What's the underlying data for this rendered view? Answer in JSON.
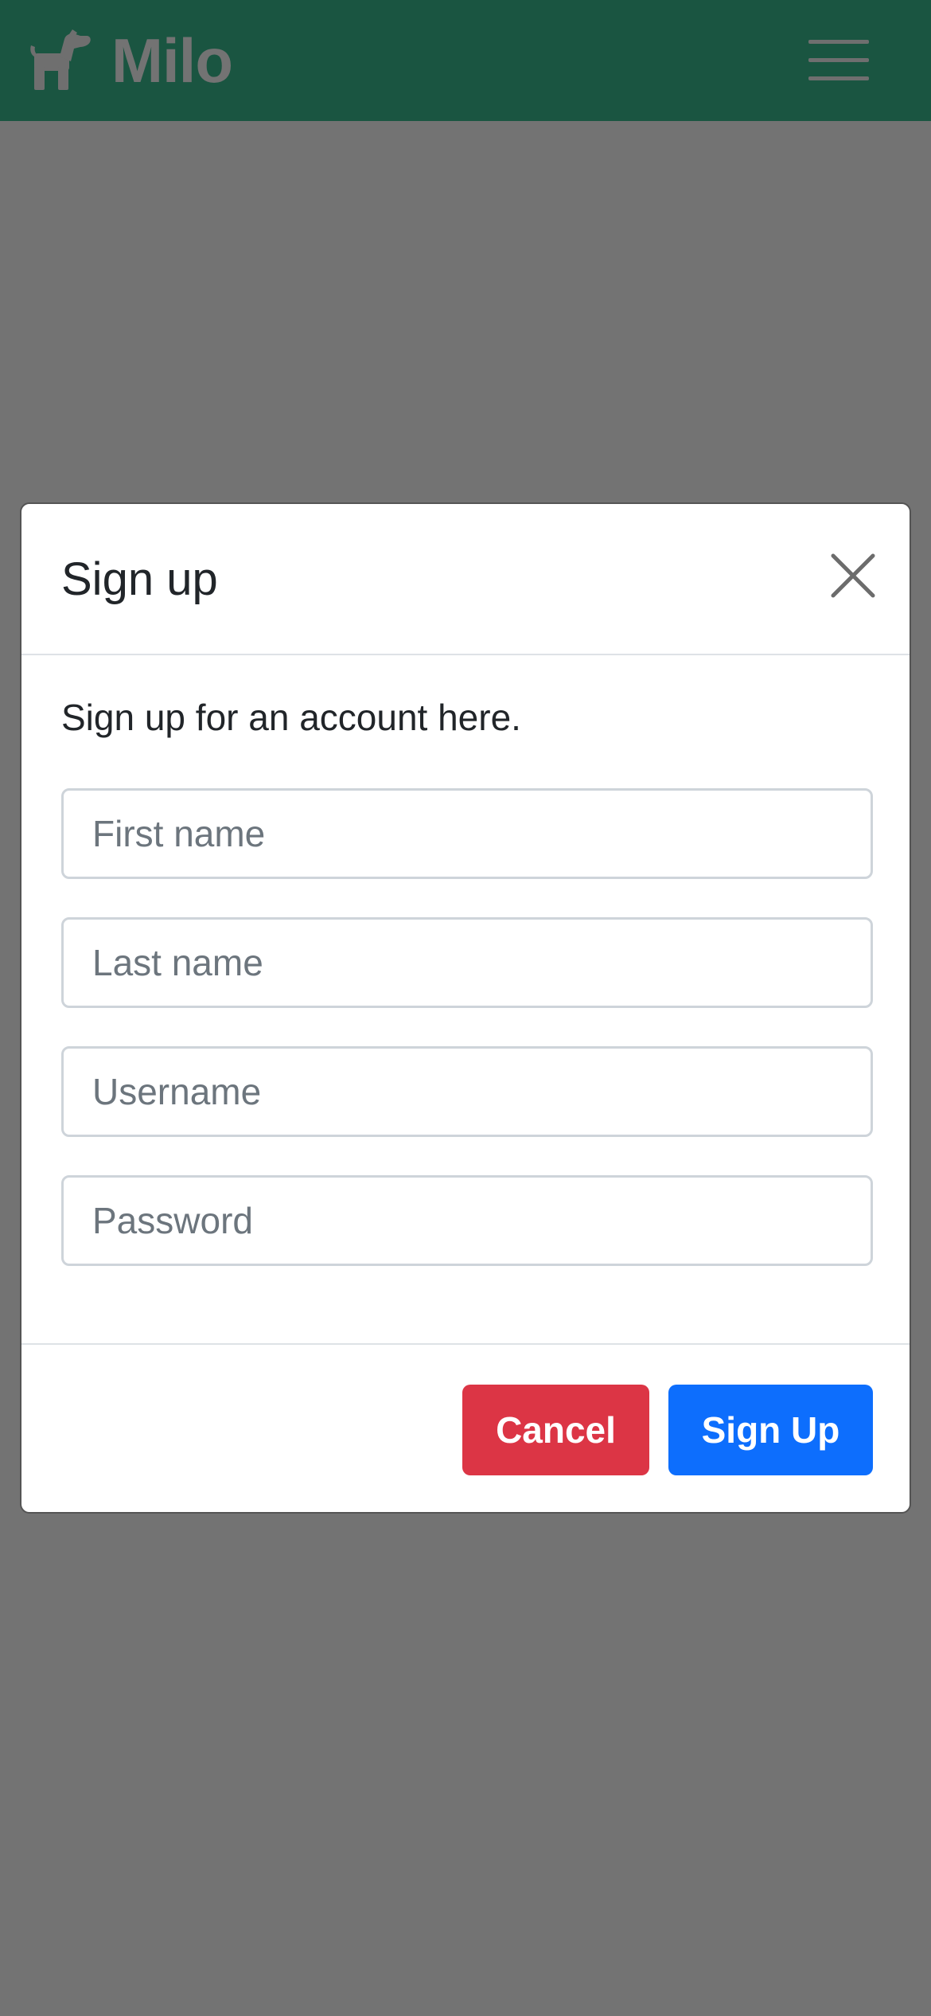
{
  "navbar": {
    "brand": "Milo",
    "brand_icon": "dog-icon",
    "menu_icon": "hamburger-menu-icon",
    "background_color": "#1a5541"
  },
  "modal": {
    "title": "Sign up",
    "close_icon": "close-icon",
    "subtitle": "Sign up for an account here.",
    "fields": {
      "first_name": {
        "placeholder": "First name",
        "value": ""
      },
      "last_name": {
        "placeholder": "Last name",
        "value": ""
      },
      "username": {
        "placeholder": "Username",
        "value": ""
      },
      "password": {
        "placeholder": "Password",
        "value": ""
      }
    },
    "buttons": {
      "cancel_label": "Cancel",
      "signup_label": "Sign Up"
    }
  },
  "colors": {
    "backdrop": "#737373",
    "cancel": "#dc3545",
    "primary": "#0d6efd"
  }
}
